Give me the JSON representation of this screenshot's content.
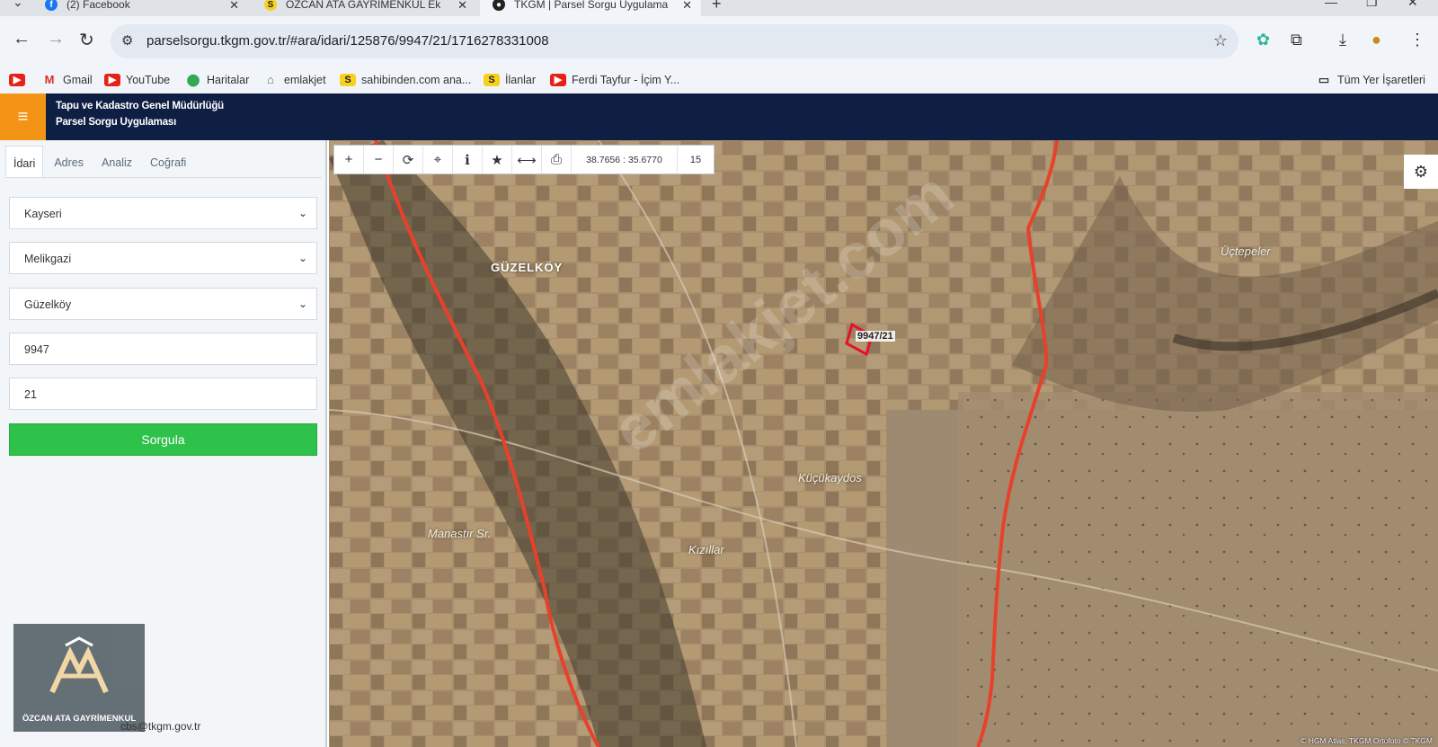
{
  "browser": {
    "tabs": [
      {
        "title": "(2) Facebook"
      },
      {
        "title": "ÖZCAN ATA GAYRİMENKUL Ek"
      },
      {
        "title": "TKGM | Parsel Sorgu Uygulama"
      }
    ],
    "url": "parselsorgu.tkgm.gov.tr/#ara/idari/125876/9947/21/1716278331008",
    "bookmarks": [
      {
        "label": "",
        "icon": "youtube-icon"
      },
      {
        "label": "Gmail",
        "icon": "gmail-icon"
      },
      {
        "label": "YouTube",
        "icon": "youtube-icon"
      },
      {
        "label": "Haritalar",
        "icon": "maps-icon"
      },
      {
        "label": "emlakjet",
        "icon": "house-icon"
      },
      {
        "label": "sahibinden.com ana...",
        "icon": "s-icon"
      },
      {
        "label": "İlanlar",
        "icon": "s-icon"
      },
      {
        "label": "Ferdi Tayfur - İçim Y...",
        "icon": "youtube-icon"
      }
    ],
    "all_bookmarks": "Tüm Yer İşaretleri"
  },
  "app": {
    "title_line1": "Tapu ve Kadastro Genel Müdürlüğü",
    "title_line2": "Parsel Sorgu Uygulaması"
  },
  "panel": {
    "tabs": [
      "İdari",
      "Adres",
      "Analiz",
      "Coğrafi"
    ],
    "il": "Kayseri",
    "ilce": "Melikgazi",
    "mahalle": "Güzelköy",
    "ada": "9947",
    "parsel": "21",
    "query_button": "Sorgula",
    "footer_email": "cbs@tkgm.gov.tr",
    "logo_text": "ÖZCAN ATA GAYRİMENKUL"
  },
  "map": {
    "coords": "38.7656 : 35.6770",
    "zoom": "15",
    "parcel_label": "9947/21",
    "places": {
      "guzelkoy": "GÜZELKÖY",
      "uctepeler": "Üçtepeler",
      "kucukaydos": "Küçükaydos",
      "monastir": "Manastır Sr.",
      "kizillar": "Kızıllar"
    },
    "watermark": "emlakjet.com",
    "attribution": "© HGM Atlas, TKGM Ortofoto © TKGM"
  }
}
